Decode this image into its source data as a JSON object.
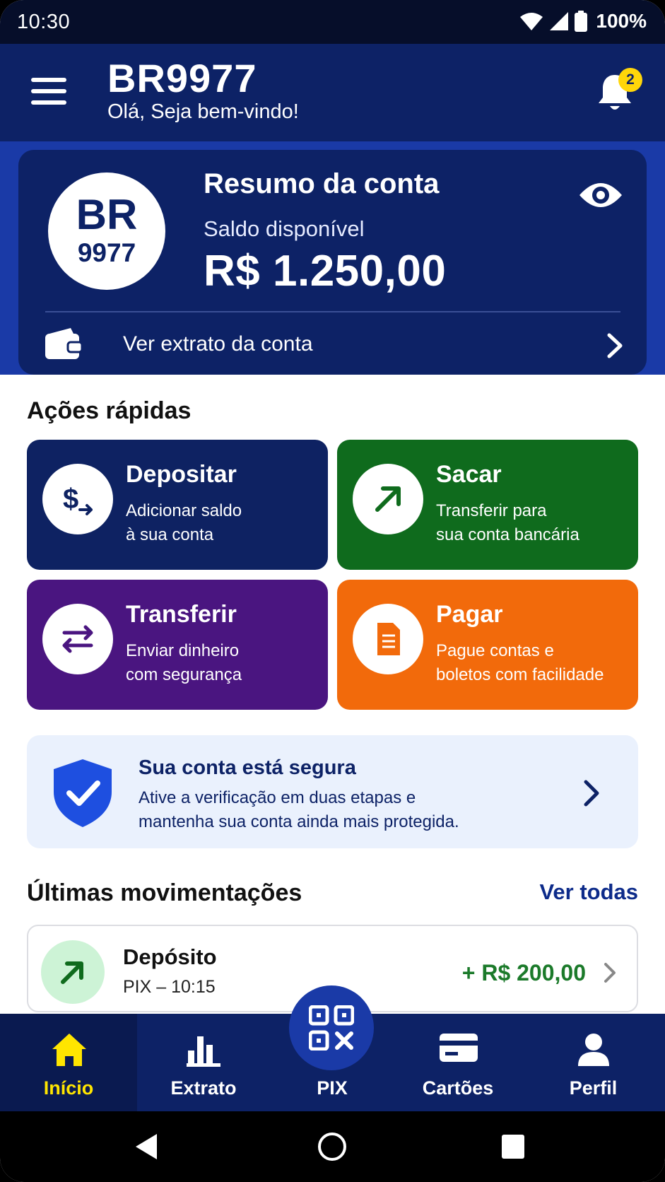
{
  "status_bar": {
    "time": "10:30",
    "battery": "100%"
  },
  "header": {
    "title": "BR9977",
    "subtitle": "Olá, Seja bem-vindo!",
    "notification_count": "2"
  },
  "summary": {
    "avatar_line1": "BR",
    "avatar_line2": "9977",
    "title": "Resumo da conta",
    "balance_label": "Saldo disponível",
    "balance_value": "R$ 1.250,00",
    "statement_link": "Ver extrato da conta"
  },
  "quick_actions": {
    "title": "Ações rápidas",
    "items": [
      {
        "title": "Depositar",
        "line1": "Adicionar saldo",
        "line2": "à sua conta",
        "color": "#0e2262"
      },
      {
        "title": "Sacar",
        "line1": "Transferir para",
        "line2": "sua conta bancária",
        "color": "#0f6b1d"
      },
      {
        "title": "Transferir",
        "line1": "Enviar dinheiro",
        "line2": "com segurança",
        "color": "#4a1580"
      },
      {
        "title": "Pagar",
        "line1": "Pague contas e",
        "line2": "boletos com facilidade",
        "color": "#f26a0b"
      }
    ]
  },
  "security": {
    "title": "Sua conta está segura",
    "line1": "Ative a verificação em duas etapas e",
    "line2": "mantenha sua conta ainda mais protegida."
  },
  "transactions": {
    "title": "Últimas movimentações",
    "see_all": "Ver todas",
    "items": [
      {
        "title": "Depósito",
        "meta": "PIX – 10:15",
        "amount": "+ R$ 200,00"
      }
    ]
  },
  "bottom_nav": {
    "items": [
      {
        "label": "Início",
        "icon": "home-icon",
        "active": true
      },
      {
        "label": "Extrato",
        "icon": "bar-chart-icon"
      },
      {
        "label": "PIX",
        "icon": "qr-code-icon"
      },
      {
        "label": "Cartões",
        "icon": "credit-card-icon"
      },
      {
        "label": "Perfil",
        "icon": "user-icon"
      }
    ]
  },
  "colors": {
    "primary": "#0d2266",
    "accent_yellow": "#ffe500",
    "success": "#1b7a2a"
  }
}
